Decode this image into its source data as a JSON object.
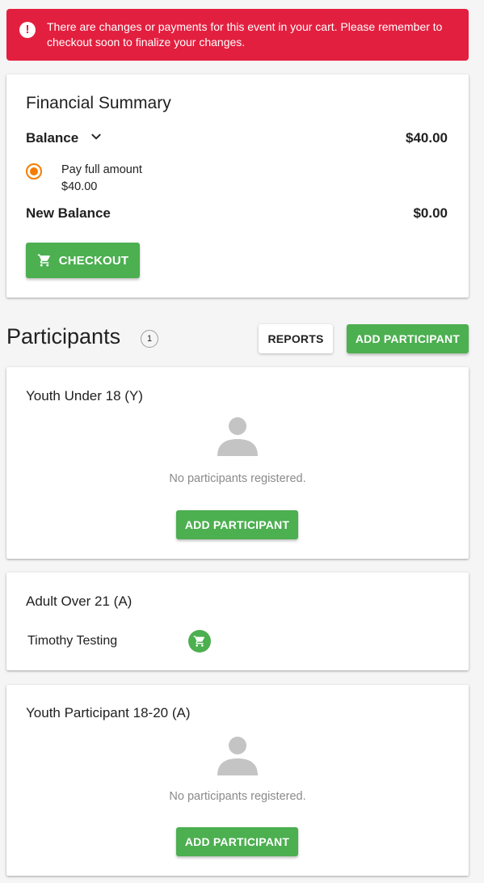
{
  "alert": {
    "icon": "exclamation-icon",
    "message": "There are changes or payments for this event in your cart. Please remember to checkout soon to finalize your changes.",
    "color": "#e31f3f"
  },
  "financial": {
    "title": "Financial Summary",
    "balance_label": "Balance",
    "balance_amount": "$40.00",
    "pay_option_label": "Pay full amount",
    "pay_option_amount": "$40.00",
    "new_balance_label": "New Balance",
    "new_balance_amount": "$0.00",
    "checkout_label": "CHECKOUT"
  },
  "participants": {
    "title": "Participants",
    "count": "1",
    "reports_label": "REPORTS",
    "add_label": "ADD PARTICIPANT",
    "categories": [
      {
        "title": "Youth Under 18 (Y)",
        "empty_text": "No participants registered.",
        "add_label": "ADD PARTICIPANT"
      },
      {
        "title": "Adult Over 21 (A)",
        "members": [
          {
            "name": "Timothy Testing",
            "status_icon": "cart-icon"
          }
        ]
      },
      {
        "title": "Youth Participant 18-20 (A)",
        "empty_text": "No participants registered.",
        "add_label": "ADD PARTICIPANT"
      }
    ]
  },
  "colors": {
    "primary_green": "#4caf50",
    "radio_orange": "#f57c00",
    "alert_red": "#e31f3f"
  }
}
